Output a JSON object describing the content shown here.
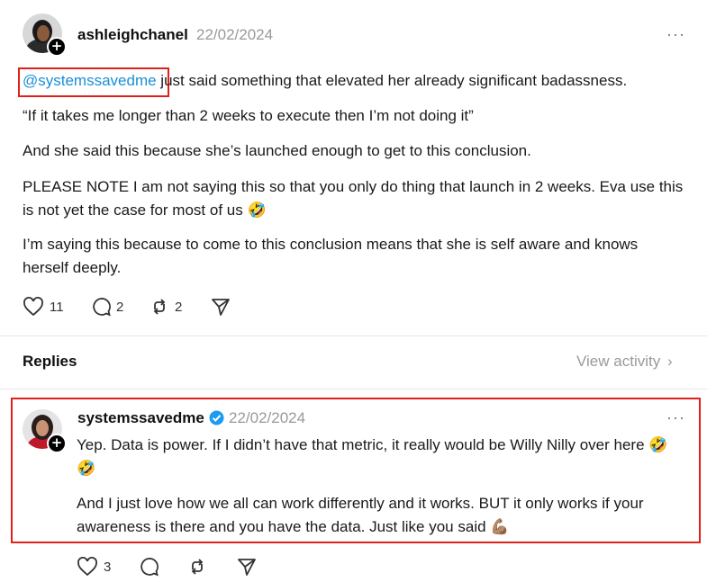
{
  "post": {
    "username": "ashleighchanel",
    "date": "22/02/2024",
    "more_label": "···",
    "mention": "@systemssavedme",
    "line1_rest": " just said something that elevated her already significant badassness.",
    "para2": "“If it takes me longer than 2 weeks to execute then I’m not doing it”",
    "para3": "And she said this because she’s launched enough to get to this conclusion.",
    "para4": "PLEASE NOTE I am not saying this so that you only do thing that launch in 2 weeks. Eva use this is not yet the case for most of us",
    "para4_emoji": "🤣",
    "para5": "I’m saying this because to come to this conclusion means that she is self aware and knows herself deeply.",
    "actions": {
      "likes": "11",
      "comments": "2",
      "reposts": "2"
    }
  },
  "replies_header": {
    "label": "Replies",
    "view_activity": "View activity",
    "chevron": "›"
  },
  "reply": {
    "username": "systemssavedme",
    "date": "22/02/2024",
    "more_label": "···",
    "para1": "Yep. Data is power. If I didn’t have that metric, it really would be Willy Nilly over here",
    "para1_emoji": "🤣🤣",
    "para2": "And I just love how we all can work differently and it works. BUT it only works if your awareness is there and you have the data. Just like you said",
    "para2_emoji": "💪🏽",
    "actions": {
      "likes": "3"
    }
  },
  "colors": {
    "highlight": "#e0211a",
    "mention": "#1a8fd6",
    "verified": "#1d9bf0"
  }
}
